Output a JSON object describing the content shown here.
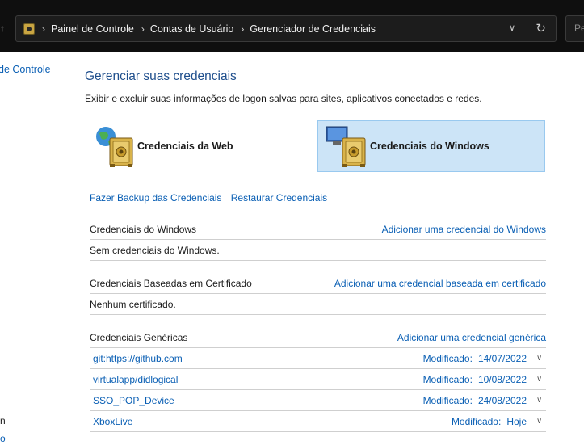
{
  "addressbar": {
    "breadcrumbs": [
      "Painel de Controle",
      "Contas de Usuário",
      "Gerenciador de Credenciais"
    ],
    "search_placeholder": "Pe"
  },
  "leftnav": {
    "home_link": "de Controle",
    "bottom_text": "n",
    "bottom_link": "o"
  },
  "main": {
    "title": "Gerenciar suas credenciais",
    "description": "Exibir e excluir suas informações de logon salvas para sites, aplicativos conectados e redes.",
    "tiles": [
      {
        "label": "Credenciais da Web",
        "selected": false
      },
      {
        "label": "Credenciais do Windows",
        "selected": true
      }
    ],
    "backup_label": "Fazer Backup das Credenciais",
    "restore_label": "Restaurar Credenciais"
  },
  "sections": {
    "windows": {
      "title": "Credenciais do Windows",
      "add_label": "Adicionar uma credencial do Windows",
      "empty_text": "Sem credenciais do Windows."
    },
    "certificate": {
      "title": "Credenciais Baseadas em Certificado",
      "add_label": "Adicionar uma credencial baseada em certificado",
      "empty_text": "Nenhum certificado."
    },
    "generic": {
      "title": "Credenciais Genéricas",
      "add_label": "Adicionar uma credencial genérica",
      "modified_label": "Modificado:",
      "items": [
        {
          "name": "git:https://github.com",
          "date": "14/07/2022"
        },
        {
          "name": "virtualapp/didlogical",
          "date": "10/08/2022"
        },
        {
          "name": "SSO_POP_Device",
          "date": "24/08/2022"
        },
        {
          "name": "XboxLive",
          "date": "Hoje"
        }
      ]
    }
  },
  "colors": {
    "link": "#0a5fb4",
    "title": "#1e4e8c",
    "selected_tile_bg": "#cce4f7",
    "topbar_bg": "#0f0f0f"
  }
}
